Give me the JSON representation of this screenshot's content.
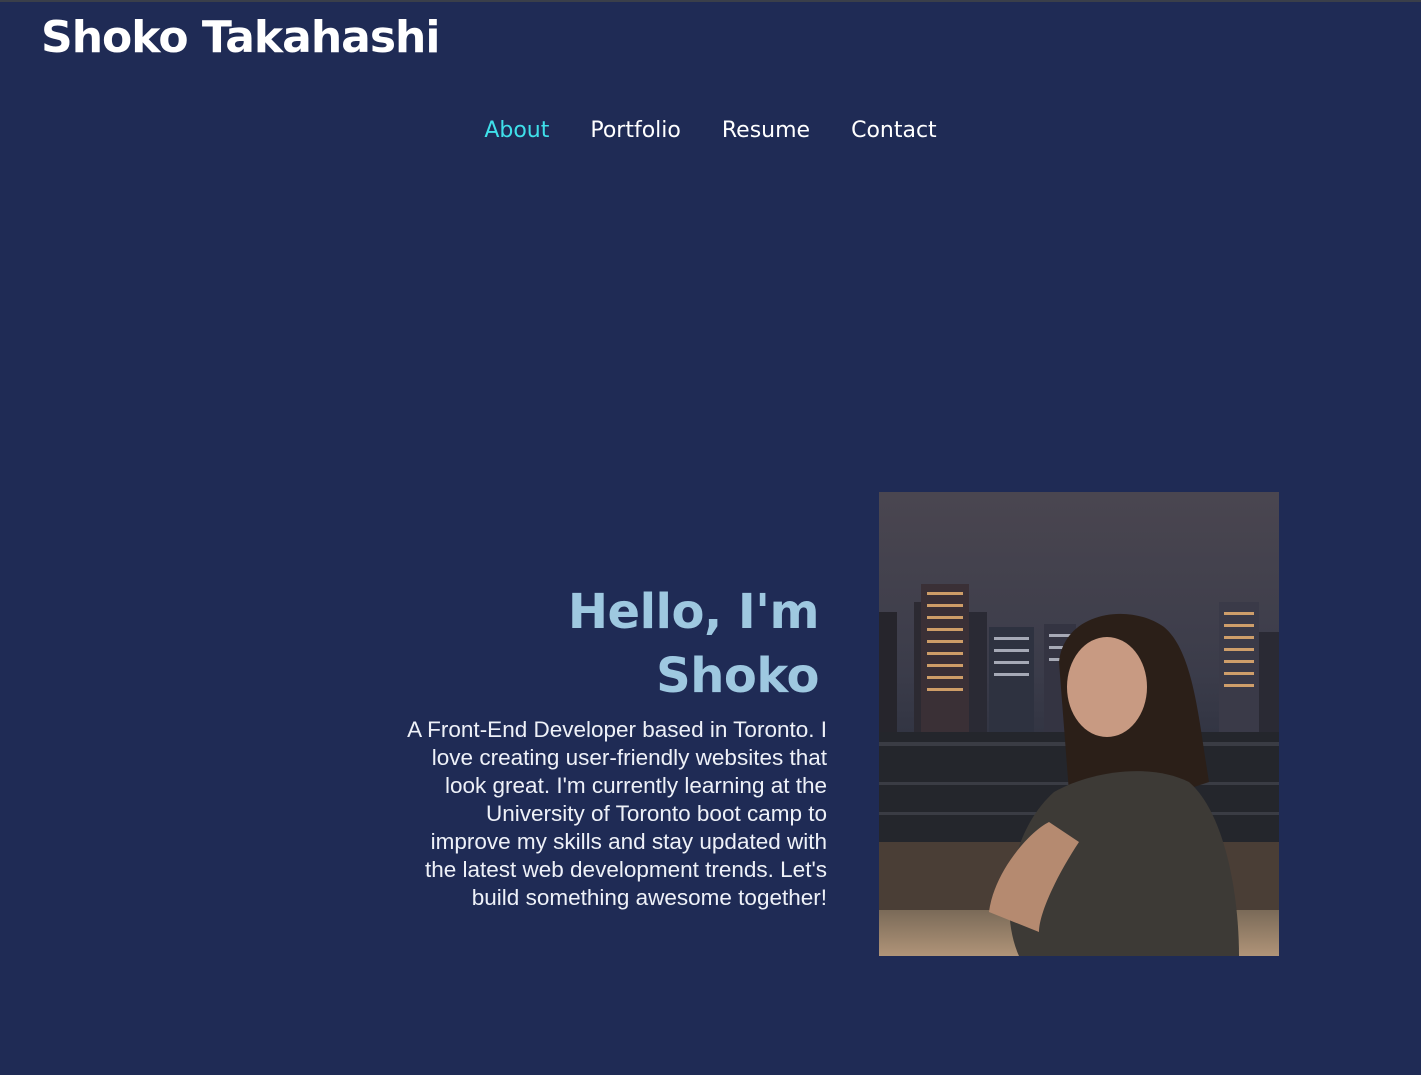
{
  "header": {
    "title": "Shoko Takahashi"
  },
  "nav": {
    "items": [
      {
        "label": "About",
        "active": true
      },
      {
        "label": "Portfolio",
        "active": false
      },
      {
        "label": "Resume",
        "active": false
      },
      {
        "label": "Contact",
        "active": false
      }
    ]
  },
  "about": {
    "heading": "Hello, I'm Shoko",
    "bio": "A Front-End Developer based in Toronto. I love creating user-friendly websites that look great. I'm currently learning at the University of Toronto boot camp to improve my skills and stay updated with the latest web development trends. Let's build something awesome together!"
  },
  "colors": {
    "background": "#1f2b55",
    "nav_active": "#3fe0ea",
    "heading": "#9ec8e0",
    "text": "#ffffff"
  }
}
